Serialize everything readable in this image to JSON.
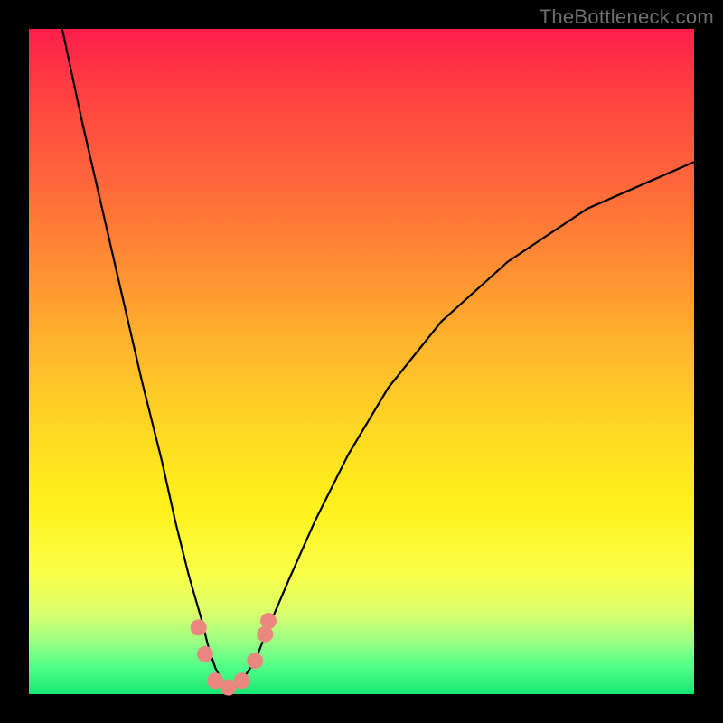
{
  "watermark": "TheBottleneck.com",
  "chart_data": {
    "type": "line",
    "title": "",
    "xlabel": "",
    "ylabel": "",
    "xlim": [
      0,
      100
    ],
    "ylim": [
      0,
      100
    ],
    "series": [
      {
        "name": "bottleneck-curve",
        "x": [
          5,
          8,
          11,
          14,
          17,
          20,
          22,
          24,
          26,
          27,
          28,
          29,
          30,
          31,
          32,
          34,
          36,
          39,
          43,
          48,
          54,
          62,
          72,
          84,
          100
        ],
        "y": [
          100,
          86,
          73,
          60,
          47,
          35,
          26,
          18,
          11,
          7,
          4,
          2,
          1,
          1,
          2,
          5,
          10,
          17,
          26,
          36,
          46,
          56,
          65,
          73,
          80
        ]
      }
    ],
    "markers": [
      {
        "x": 25.5,
        "y": 10,
        "name": "left-cluster-top"
      },
      {
        "x": 26.5,
        "y": 6,
        "name": "left-cluster-mid"
      },
      {
        "x": 28,
        "y": 2,
        "name": "valley-left"
      },
      {
        "x": 30,
        "y": 1,
        "name": "valley-min"
      },
      {
        "x": 32,
        "y": 2,
        "name": "valley-right"
      },
      {
        "x": 34,
        "y": 5,
        "name": "right-cluster-mid"
      },
      {
        "x": 35.5,
        "y": 9,
        "name": "right-cluster-top"
      },
      {
        "x": 36,
        "y": 11,
        "name": "right-cluster-top2"
      }
    ],
    "colors": {
      "curve": "#000000",
      "marker": "#e98780",
      "background_top": "#ff1e4a",
      "background_bottom": "#17e772"
    }
  }
}
